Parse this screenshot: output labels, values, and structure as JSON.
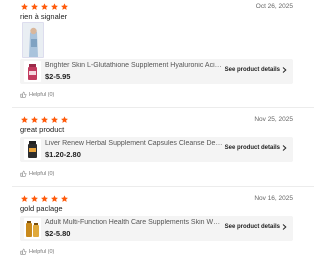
{
  "colors": {
    "star": "#ff5a0a",
    "text": "#222222",
    "muted": "#777777",
    "card": "#f4f4f4"
  },
  "icons": {
    "rating": "star-icon",
    "link": "chevron-right-icon",
    "helpful": "thumbs-up-icon"
  },
  "reviews": [
    {
      "rating": 5,
      "date": "Oct 26, 2025",
      "text": "rien à signaler",
      "has_photo": true,
      "product": {
        "name": "Brighter Skin L-Glutathione Supplement Hyaluronic Acid Co...",
        "price": "$2-5.95"
      },
      "see_details": "See product details",
      "helpful": "Helpful (0)"
    },
    {
      "rating": 5,
      "date": "Nov 25, 2025",
      "text": "great product",
      "has_photo": false,
      "product": {
        "name": "Liver Renew Herbal Supplement Capsules Cleanse Detox R...",
        "price": "$1.20-2.80"
      },
      "see_details": "See product details",
      "helpful": "Helpful (0)"
    },
    {
      "rating": 5,
      "date": "Nov 16, 2025",
      "text": "gold paclage",
      "has_photo": false,
      "product": {
        "name": "Adult Multi-Function Health Care Supplements Skin Whiten...",
        "price": "$2-5.80"
      },
      "see_details": "See product details",
      "helpful": "Helpful (0)"
    }
  ]
}
